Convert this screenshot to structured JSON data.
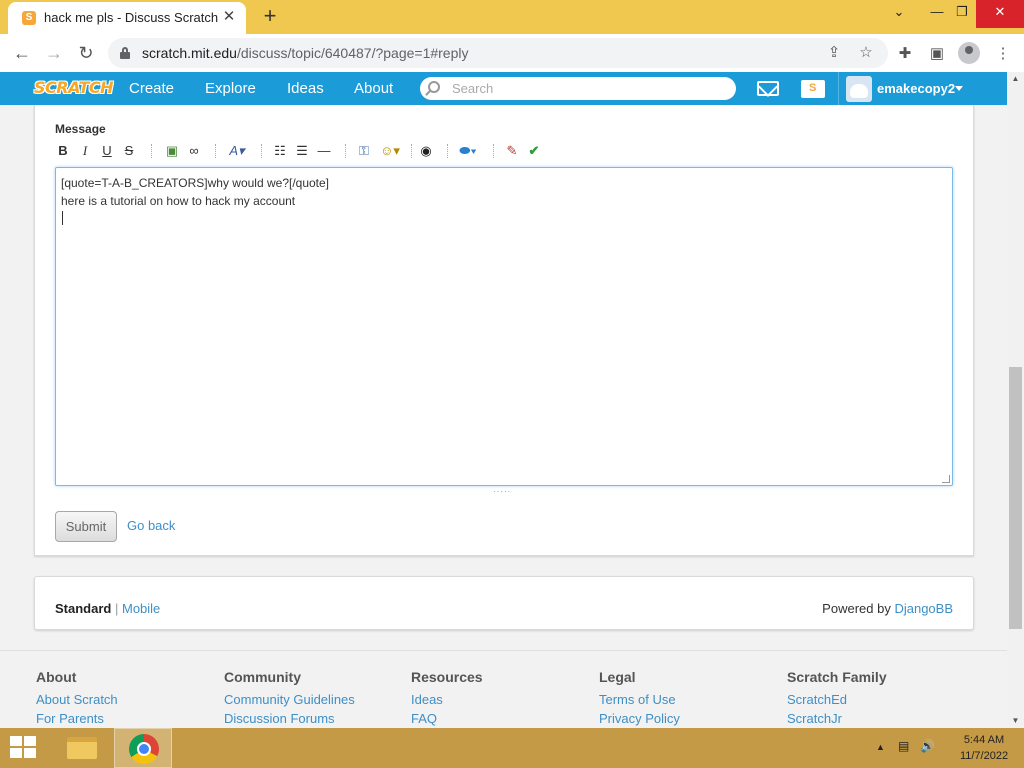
{
  "browser": {
    "tab_title": "hack me pls - Discuss Scratch",
    "tab_favicon": "S",
    "new_tab": "+",
    "url_host": "scratch.mit.edu",
    "url_path": "/discuss/topic/640487/?page=1#reply",
    "window_controls": {
      "minimize": "—",
      "maximize": "❐",
      "close": "✕",
      "chevron": "⌄"
    },
    "nav": {
      "back": "←",
      "forward": "→",
      "reload": "↻"
    }
  },
  "scratch_nav": {
    "logo": "SCRATCH",
    "links": [
      "Create",
      "Explore",
      "Ideas",
      "About"
    ],
    "search_placeholder": "Search",
    "username": "emakecopy2"
  },
  "reply_form": {
    "label": "Message",
    "toolbar": {
      "bold": "B",
      "italic": "I",
      "underline": "U",
      "strike": "S",
      "image": "▣",
      "link": "∞",
      "font": "A▾",
      "bullets": "☷",
      "numbered": "☰",
      "hr": "—",
      "code": "⚿",
      "emoji": "☺▾",
      "globe": "◉",
      "scratchblocks": "⬬▾",
      "clean": "✎",
      "preview": "✔"
    },
    "message_text": "[quote=T-A-B_CREATORS]why would we?[/quote]\nhere is a tutorial on how to hack my account",
    "resize_dots": "·····",
    "submit_label": "Submit",
    "go_back_label": "Go back"
  },
  "forum_footer": {
    "standard": "Standard",
    "separator": "|",
    "mobile": "Mobile",
    "powered_by": "Powered by",
    "djangobb": "DjangoBB"
  },
  "site_footer": {
    "columns": [
      {
        "title": "About",
        "links": [
          "About Scratch",
          "For Parents"
        ]
      },
      {
        "title": "Community",
        "links": [
          "Community Guidelines",
          "Discussion Forums"
        ]
      },
      {
        "title": "Resources",
        "links": [
          "Ideas",
          "FAQ"
        ]
      },
      {
        "title": "Legal",
        "links": [
          "Terms of Use",
          "Privacy Policy"
        ]
      },
      {
        "title": "Scratch Family",
        "links": [
          "ScratchEd",
          "ScratchJr"
        ]
      }
    ]
  },
  "scrollbar": {
    "up": "▲",
    "down": "▼"
  },
  "taskbar": {
    "time": "5:44 AM",
    "date": "11/7/2022",
    "tray": {
      "chevron": "▲",
      "network": "▤",
      "volume": "🔊"
    }
  },
  "colors": {
    "scratch_blue": "#1b9bd8",
    "link_blue": "#3d8fc6",
    "titlebar": "#f1c84f",
    "taskbar": "#c59a46"
  }
}
